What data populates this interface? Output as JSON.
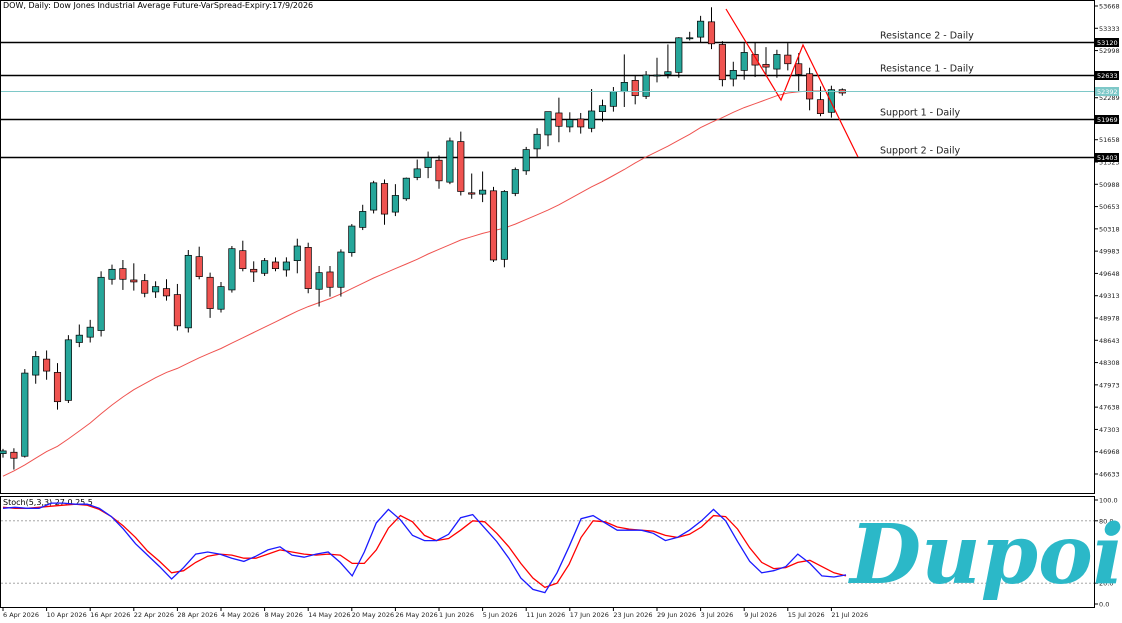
{
  "chart_title": "DOW, Daily: Dow Jones Industrial Average Future-VarSpread-Expiry:17/9/2026",
  "brand_logo_text": "Dupoin",
  "colors": {
    "bull": "#26a69a",
    "bear": "#ef5350",
    "ma": "#ef5350",
    "current_line": "#7ec8c8",
    "stoch_main": "#1a1aff",
    "stoch_signal": "#ff0000",
    "trendline": "#ff0000",
    "logo": "#2bb8c8"
  },
  "price_axis": {
    "ticks": [
      53668,
      53333,
      52998,
      52633,
      52289,
      51969,
      51658,
      51323,
      50988,
      50653,
      50318,
      49983,
      49648,
      49313,
      48978,
      48643,
      48308,
      47973,
      47638,
      47303,
      46968,
      46633
    ],
    "range": [
      46300,
      53750
    ]
  },
  "date_axis": {
    "labels": [
      "6 Apr 2026",
      "10 Apr 2026",
      "16 Apr 2026",
      "22 Apr 2026",
      "28 Apr 2026",
      "4 May 2026",
      "8 May 2026",
      "14 May 2026",
      "20 May 2026",
      "26 May 2026",
      "1 Jun 2026",
      "5 Jun 2026",
      "11 Jun 2026",
      "17 Jun 2026",
      "23 Jun 2026",
      "29 Jun 2026",
      "3 Jul 2026",
      "9 Jul 2026",
      "15 Jul 2026",
      "21 Jul 2026"
    ],
    "label_bar_index": [
      0,
      4,
      8,
      12,
      16,
      20,
      24,
      28,
      32,
      36,
      40,
      44,
      48,
      52,
      56,
      60,
      64,
      68,
      72,
      76
    ]
  },
  "levels": [
    {
      "name": "Resistance 2 - Daily",
      "price": 53120,
      "tag": "53120"
    },
    {
      "name": "Resistance 1 - Daily",
      "price": 52633,
      "tag": "52633"
    },
    {
      "name": "Support 1 - Daily",
      "price": 51969,
      "tag": "51969"
    },
    {
      "name": "Support 2 - Daily",
      "price": 51403,
      "tag": "51403"
    }
  ],
  "current_price": {
    "price": 52392,
    "tag": "52392"
  },
  "stochastic": {
    "label": "Stoch(5,3,3) 27.0 25.5",
    "ticks": [
      "100.0",
      "80.0",
      "20.0",
      "0.0"
    ],
    "tick_values": [
      100,
      80,
      20,
      0
    ],
    "levels": [
      80,
      20
    ],
    "main": [
      92,
      93,
      92,
      92,
      97,
      97,
      96,
      96,
      92,
      84,
      72,
      58,
      47,
      36,
      24,
      35,
      48,
      50,
      48,
      44,
      41,
      46,
      52,
      55,
      47,
      45,
      48,
      50,
      40,
      27,
      50,
      78,
      91,
      81,
      66,
      61,
      61,
      67,
      83,
      86,
      73,
      60,
      44,
      25,
      14,
      11,
      30,
      55,
      82,
      85,
      78,
      71,
      71,
      71,
      68,
      61,
      64,
      71,
      80,
      91,
      80,
      60,
      41,
      30,
      32,
      36,
      48,
      39,
      27,
      26,
      28
    ],
    "signal": [
      93,
      92,
      92,
      93,
      94,
      95,
      96,
      95,
      91,
      84,
      75,
      64,
      51,
      41,
      30,
      32,
      40,
      46,
      48,
      47,
      44,
      44,
      48,
      52,
      50,
      48,
      47,
      48,
      47,
      39,
      39,
      52,
      73,
      85,
      79,
      66,
      61,
      63,
      71,
      80,
      79,
      68,
      55,
      39,
      25,
      16,
      20,
      38,
      64,
      80,
      79,
      74,
      72,
      71,
      70,
      66,
      64,
      67,
      74,
      85,
      84,
      72,
      54,
      40,
      34,
      35,
      40,
      42,
      36,
      30,
      27
    ]
  },
  "chart_data": {
    "type": "candlestick",
    "title": "DOW, Daily: Dow Jones Industrial Average Future-VarSpread-Expiry:17/9/2026",
    "ohlc": [
      [
        46940,
        47010,
        46880,
        46980
      ],
      [
        46960,
        47020,
        46700,
        46870
      ],
      [
        46900,
        48210,
        46880,
        48150
      ],
      [
        48120,
        48480,
        47990,
        48400
      ],
      [
        48360,
        48490,
        48050,
        48180
      ],
      [
        48160,
        48300,
        47600,
        47720
      ],
      [
        47740,
        48720,
        47700,
        48650
      ],
      [
        48610,
        48880,
        48540,
        48720
      ],
      [
        48690,
        48950,
        48610,
        48840
      ],
      [
        48790,
        49680,
        48700,
        49590
      ],
      [
        49560,
        49780,
        49480,
        49710
      ],
      [
        49720,
        49850,
        49400,
        49560
      ],
      [
        49550,
        49800,
        49390,
        49520
      ],
      [
        49540,
        49640,
        49290,
        49350
      ],
      [
        49370,
        49530,
        49280,
        49450
      ],
      [
        49420,
        49560,
        49240,
        49310
      ],
      [
        49330,
        49490,
        48790,
        48860
      ],
      [
        48830,
        50000,
        48760,
        49920
      ],
      [
        49900,
        50050,
        49560,
        49600
      ],
      [
        49590,
        49660,
        48980,
        49120
      ],
      [
        49110,
        49520,
        49060,
        49450
      ],
      [
        49400,
        50060,
        49360,
        50020
      ],
      [
        49990,
        50140,
        49680,
        49720
      ],
      [
        49710,
        49830,
        49520,
        49670
      ],
      [
        49650,
        49880,
        49610,
        49840
      ],
      [
        49820,
        49890,
        49680,
        49720
      ],
      [
        49700,
        49890,
        49600,
        49820
      ],
      [
        49840,
        50170,
        49650,
        50060
      ],
      [
        50040,
        50110,
        49350,
        49420
      ],
      [
        49410,
        49760,
        49150,
        49660
      ],
      [
        49670,
        49760,
        49300,
        49440
      ],
      [
        49440,
        50010,
        49300,
        49970
      ],
      [
        49960,
        50390,
        49900,
        50360
      ],
      [
        50340,
        50680,
        50300,
        50580
      ],
      [
        50600,
        51040,
        50550,
        51010
      ],
      [
        51000,
        51060,
        50380,
        50540
      ],
      [
        50570,
        50990,
        50510,
        50820
      ],
      [
        50770,
        51090,
        50740,
        51080
      ],
      [
        51090,
        51360,
        51050,
        51220
      ],
      [
        51240,
        51480,
        51080,
        51390
      ],
      [
        51350,
        51420,
        50920,
        51040
      ],
      [
        51020,
        51690,
        50990,
        51640
      ],
      [
        51630,
        51780,
        50820,
        50880
      ],
      [
        50860,
        51150,
        50770,
        50840
      ],
      [
        50840,
        51180,
        50720,
        50900
      ],
      [
        50890,
        50950,
        49820,
        49850
      ],
      [
        49860,
        50900,
        49740,
        50880
      ],
      [
        50850,
        51240,
        50810,
        51210
      ],
      [
        51190,
        51550,
        51130,
        51510
      ],
      [
        51520,
        51830,
        51400,
        51740
      ],
      [
        51730,
        52020,
        51560,
        52080
      ],
      [
        52060,
        52290,
        51620,
        51860
      ],
      [
        51850,
        52070,
        51770,
        51960
      ],
      [
        51970,
        52060,
        51750,
        51850
      ],
      [
        51830,
        52420,
        51770,
        52090
      ],
      [
        52080,
        52260,
        51930,
        52170
      ],
      [
        52160,
        52450,
        52080,
        52380
      ],
      [
        52380,
        52940,
        52150,
        52520
      ],
      [
        52550,
        52620,
        52190,
        52320
      ],
      [
        52310,
        52690,
        52270,
        52630
      ],
      [
        52620,
        52890,
        52520,
        52630
      ],
      [
        52640,
        53090,
        52580,
        52680
      ],
      [
        52670,
        53200,
        52590,
        53190
      ],
      [
        53180,
        53280,
        53150,
        53190
      ],
      [
        53200,
        53520,
        53120,
        53440
      ],
      [
        53430,
        53650,
        53020,
        53100
      ],
      [
        53090,
        53140,
        52460,
        52560
      ],
      [
        52570,
        52830,
        52460,
        52700
      ],
      [
        52700,
        53110,
        52560,
        52970
      ],
      [
        52940,
        53120,
        52600,
        52780
      ],
      [
        52790,
        53050,
        52610,
        52750
      ],
      [
        52720,
        53010,
        52590,
        52940
      ],
      [
        52930,
        53110,
        52700,
        52800
      ],
      [
        52800,
        52960,
        52390,
        52640
      ],
      [
        52650,
        52740,
        52100,
        52270
      ],
      [
        52260,
        52460,
        52010,
        52050
      ],
      [
        52070,
        52470,
        51990,
        52410
      ],
      [
        52410,
        52430,
        52320,
        52360
      ]
    ],
    "ma": [
      46600,
      46680,
      46770,
      46870,
      46970,
      47050,
      47160,
      47280,
      47400,
      47540,
      47670,
      47790,
      47900,
      47990,
      48080,
      48160,
      48220,
      48300,
      48380,
      48450,
      48520,
      48600,
      48680,
      48760,
      48840,
      48920,
      49000,
      49080,
      49150,
      49210,
      49270,
      49340,
      49420,
      49500,
      49580,
      49650,
      49720,
      49790,
      49860,
      49940,
      50010,
      50080,
      50150,
      50200,
      50250,
      50290,
      50330,
      50390,
      50460,
      50530,
      50600,
      50680,
      50770,
      50860,
      50950,
      51030,
      51120,
      51210,
      51310,
      51400,
      51480,
      51560,
      51650,
      51740,
      51840,
      51920,
      51990,
      52070,
      52140,
      52200,
      52260,
      52320,
      52360,
      52380,
      52390,
      52390,
      52380,
      52380
    ]
  }
}
